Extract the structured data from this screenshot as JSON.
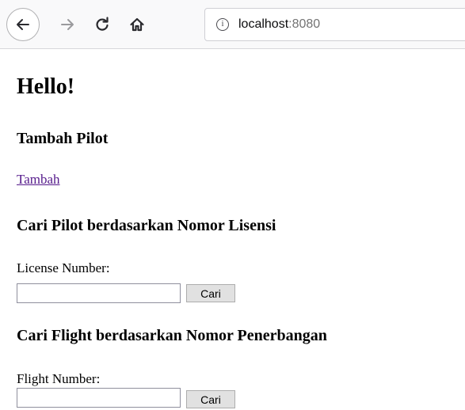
{
  "browser": {
    "url_host": "localhost",
    "url_port": ":8080",
    "info_glyph": "i",
    "icons": {
      "back": "back-arrow-icon",
      "forward": "forward-arrow-icon",
      "reload": "reload-icon",
      "home": "home-icon",
      "info": "info-icon"
    }
  },
  "page": {
    "title": "Hello!",
    "tambah_section": {
      "heading": "Tambah Pilot",
      "link_label": "Tambah"
    },
    "license_search": {
      "heading": "Cari Pilot berdasarkan Nomor Lisensi",
      "label": "License Number:",
      "input_value": "",
      "button_label": "Cari"
    },
    "flight_search": {
      "heading": "Cari Flight berdasarkan Nomor Penerbangan",
      "label": "Flight Number:",
      "input_value": "",
      "button_label": "Cari"
    }
  },
  "colors": {
    "link_visited": "#551a8b",
    "toolbar_bg": "#f9f9fa",
    "button_bg": "#e1e1e1"
  }
}
